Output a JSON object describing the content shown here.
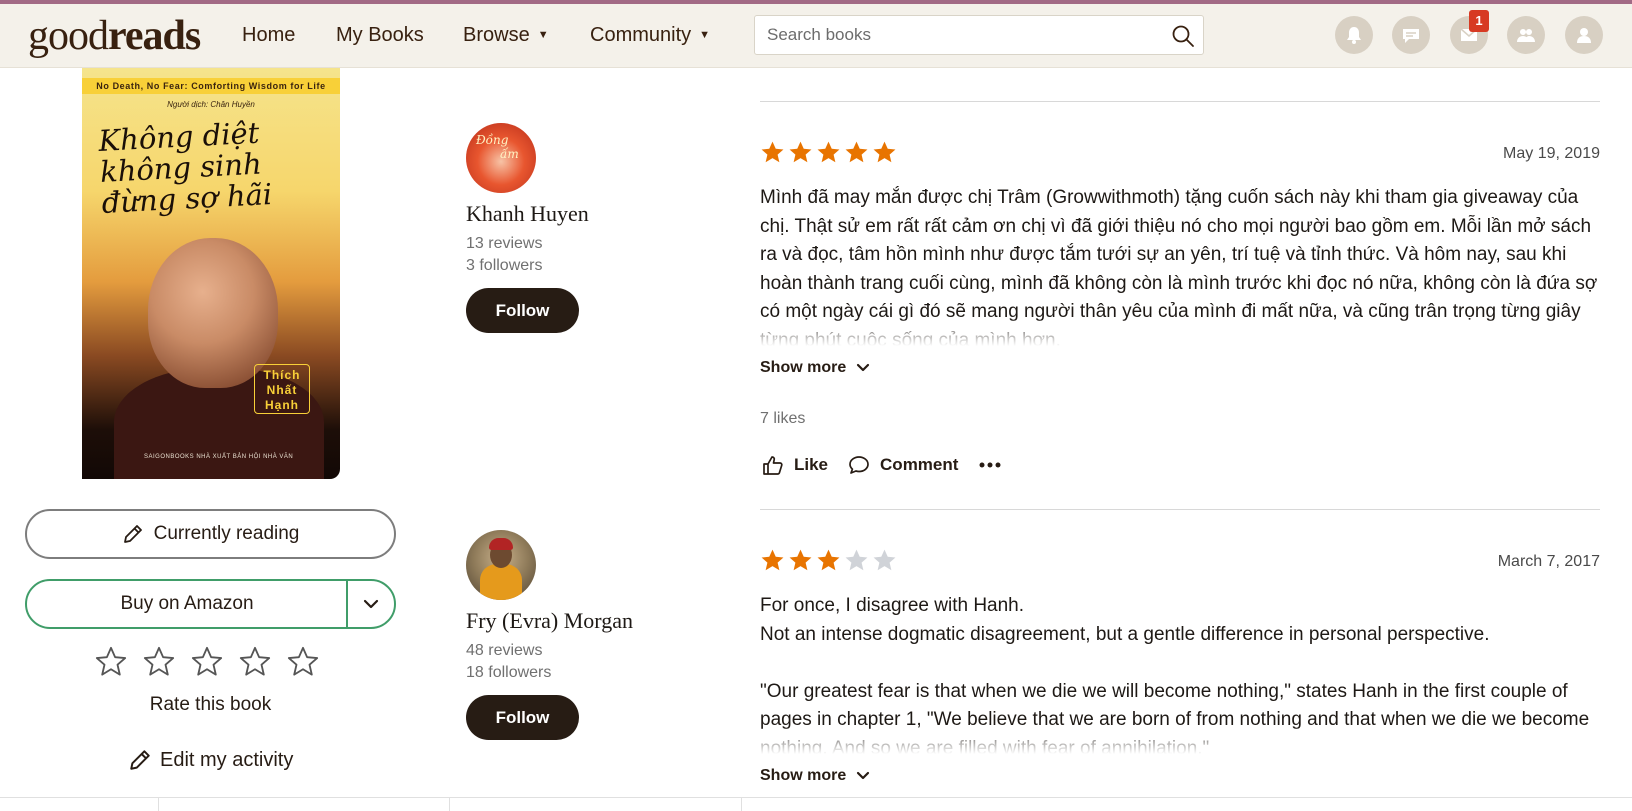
{
  "header": {
    "logo_part1": "good",
    "logo_part2": "reads",
    "nav": [
      "Home",
      "My Books",
      "Browse",
      "Community"
    ],
    "search_placeholder": "Search books",
    "messages_badge": "1",
    "icons": [
      "bell-icon",
      "chat-icon",
      "mail-icon",
      "friends-icon",
      "profile-icon"
    ]
  },
  "book": {
    "cover_band": "No Death, No Fear: Comforting Wisdom for Life",
    "cover_translator": "Người dịch: Chân Huyền",
    "cover_title": "Không diệt không sinh đừng sợ hãi",
    "cover_author": "Thích Nhất Hạnh",
    "cover_publisher": "SAIGONBOOKS   NHÀ XUẤT BẢN HỘI NHÀ VĂN",
    "reading_label": "Currently reading",
    "amazon_label": "Buy on Amazon",
    "rate_label": "Rate this book",
    "edit_label": "Edit my activity"
  },
  "reviews": [
    {
      "name": "Khanh Huyen",
      "avatar_text1": "Đồng",
      "avatar_text2": "ấm",
      "reviews_count": "13 reviews",
      "followers": "3 followers",
      "follow_label": "Follow",
      "rating": 5,
      "date": "May 19, 2019",
      "text": "Mình đã may mắn được chị Trâm (Growwithmoth) tặng cuốn sách này khi tham gia giveaway của chị. Thật sử em rất rất cảm ơn chị vì đã giới thiệu nó cho mọi người bao gồm em. Mỗi lần mở sách ra và đọc, tâm hồn mình như được tắm tưới sự an yên, trí tuệ và tỉnh thức. Và hôm nay, sau khi hoàn thành trang cuối cùng, mình đã không còn là mình trước khi đọc nó nữa, không còn là đứa sợ có một ngày cái gì đó sẽ mang người thân yêu của mình đi mất nữa, và cũng trân trọng từng giây từng phút cuộc sống của mình hơn.",
      "show_more": "Show more",
      "likes": "7 likes",
      "like_label": "Like",
      "comment_label": "Comment"
    },
    {
      "name": "Fry (Evra) Morgan",
      "reviews_count": "48 reviews",
      "followers": "18 followers",
      "follow_label": "Follow",
      "rating": 3,
      "date": "March 7, 2017",
      "text": "For once, I disagree with Hanh.\nNot an intense dogmatic disagreement, but a gentle difference in personal perspective.\n\n\"Our greatest fear is that when we die we will become nothing,\" states Hanh in the first couple of pages in chapter 1, \"We believe that we are born of from nothing and that when we die we become nothing. And so we are filled with fear of annihilation.\"",
      "show_more": "Show more"
    }
  ],
  "colors": {
    "header_bg": "#f4f1ea",
    "brand_brown": "#382110",
    "star_filled": "#e87400",
    "star_empty": "#d0d3d8",
    "amazon_border": "#409d69",
    "follow_bg": "#271c14",
    "badge_red": "#d73a23"
  }
}
